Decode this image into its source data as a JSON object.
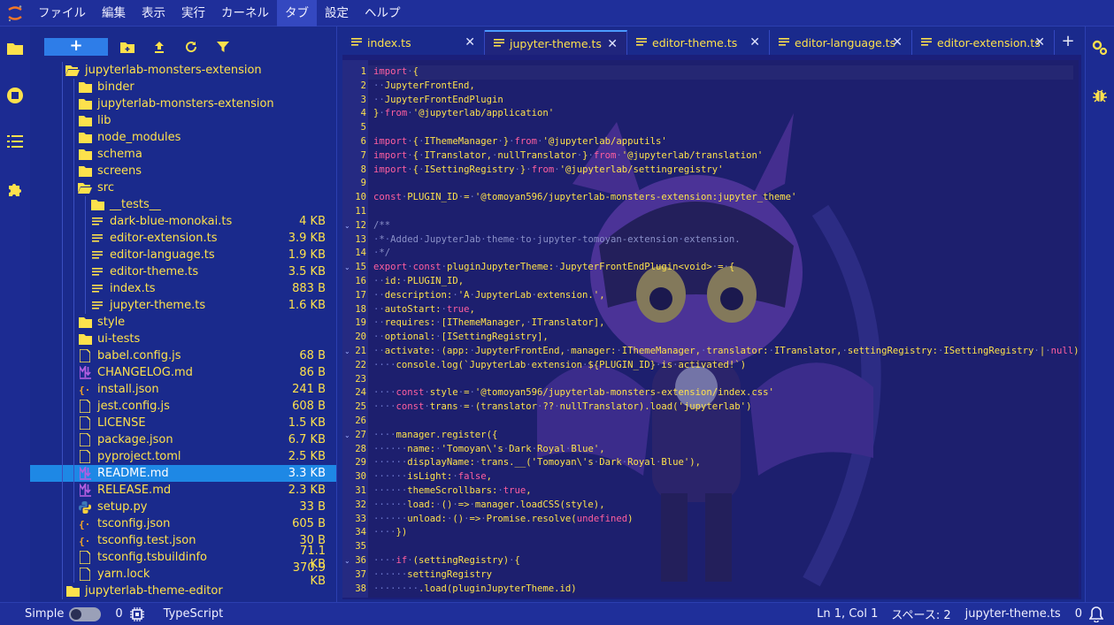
{
  "menu": [
    "ファイル",
    "編集",
    "表示",
    "実行",
    "カーネル",
    "タブ",
    "設定",
    "ヘルプ"
  ],
  "menu_active_index": 5,
  "filebrowser": {
    "new_label": "+",
    "root": "jupyterlab-monsters-extension",
    "items": [
      {
        "name": "jupyterlab-monsters-extension",
        "size": "",
        "type": "folder-open",
        "depth": 0
      },
      {
        "name": "binder",
        "size": "",
        "type": "folder",
        "depth": 1
      },
      {
        "name": "jupyterlab-monsters-extension",
        "size": "",
        "type": "folder",
        "depth": 1
      },
      {
        "name": "lib",
        "size": "",
        "type": "folder",
        "depth": 1
      },
      {
        "name": "node_modules",
        "size": "",
        "type": "folder",
        "depth": 1
      },
      {
        "name": "schema",
        "size": "",
        "type": "folder",
        "depth": 1
      },
      {
        "name": "screens",
        "size": "",
        "type": "folder",
        "depth": 1
      },
      {
        "name": "src",
        "size": "",
        "type": "folder-open",
        "depth": 1
      },
      {
        "name": "__tests__",
        "size": "",
        "type": "folder",
        "depth": 2
      },
      {
        "name": "dark-blue-monokai.ts",
        "size": "4 KB",
        "type": "ts",
        "depth": 2
      },
      {
        "name": "editor-extension.ts",
        "size": "3.9 KB",
        "type": "ts",
        "depth": 2
      },
      {
        "name": "editor-language.ts",
        "size": "1.9 KB",
        "type": "ts",
        "depth": 2
      },
      {
        "name": "editor-theme.ts",
        "size": "3.5 KB",
        "type": "ts",
        "depth": 2
      },
      {
        "name": "index.ts",
        "size": "883 B",
        "type": "ts",
        "depth": 2
      },
      {
        "name": "jupyter-theme.ts",
        "size": "1.6 KB",
        "type": "ts",
        "depth": 2
      },
      {
        "name": "style",
        "size": "",
        "type": "folder",
        "depth": 1
      },
      {
        "name": "ui-tests",
        "size": "",
        "type": "folder",
        "depth": 1
      },
      {
        "name": "babel.config.js",
        "size": "68 B",
        "type": "file",
        "depth": 1
      },
      {
        "name": "CHANGELOG.md",
        "size": "86 B",
        "type": "md",
        "depth": 1
      },
      {
        "name": "install.json",
        "size": "241 B",
        "type": "json",
        "depth": 1
      },
      {
        "name": "jest.config.js",
        "size": "608 B",
        "type": "file",
        "depth": 1
      },
      {
        "name": "LICENSE",
        "size": "1.5 KB",
        "type": "file",
        "depth": 1
      },
      {
        "name": "package.json",
        "size": "6.7 KB",
        "type": "file",
        "depth": 1
      },
      {
        "name": "pyproject.toml",
        "size": "2.5 KB",
        "type": "file",
        "depth": 1
      },
      {
        "name": "README.md",
        "size": "3.3 KB",
        "type": "md",
        "depth": 1,
        "selected": true
      },
      {
        "name": "RELEASE.md",
        "size": "2.3 KB",
        "type": "md",
        "depth": 1
      },
      {
        "name": "setup.py",
        "size": "33 B",
        "type": "py",
        "depth": 1
      },
      {
        "name": "tsconfig.json",
        "size": "605 B",
        "type": "json",
        "depth": 1
      },
      {
        "name": "tsconfig.test.json",
        "size": "30 B",
        "type": "json",
        "depth": 1
      },
      {
        "name": "tsconfig.tsbuildinfo",
        "size": "71.1 KB",
        "type": "file",
        "depth": 1
      },
      {
        "name": "yarn.lock",
        "size": "370.9 KB",
        "type": "file",
        "depth": 1
      },
      {
        "name": "jupyterlab-theme-editor",
        "size": "",
        "type": "folder",
        "depth": 0
      }
    ]
  },
  "tabs": [
    {
      "label": "index.ts",
      "active": false
    },
    {
      "label": "jupyter-theme.ts",
      "active": true
    },
    {
      "label": "editor-theme.ts",
      "active": false
    },
    {
      "label": "editor-language.ts",
      "active": false
    },
    {
      "label": "editor-extension.ts",
      "active": false
    }
  ],
  "code": [
    {
      "n": "1",
      "t": "import·{"
    },
    {
      "n": "2",
      "t": "··JupyterFrontEnd,"
    },
    {
      "n": "3",
      "t": "··JupyterFrontEndPlugin"
    },
    {
      "n": "4",
      "t": "}·from·'@jupyterlab/application'"
    },
    {
      "n": "5",
      "t": ""
    },
    {
      "n": "6",
      "t": "import·{·IThemeManager·}·from·'@jupyterlab/apputils'"
    },
    {
      "n": "7",
      "t": "import·{·ITranslator,·nullTranslator·}·from·'@jupyterlab/translation'"
    },
    {
      "n": "8",
      "t": "import·{·ISettingRegistry·}·from·'@jupyterlab/settingregistry'"
    },
    {
      "n": "9",
      "t": ""
    },
    {
      "n": "10",
      "t": "const·PLUGIN_ID·=·'@tomoyan596/jupyterlab-monsters-extension:jupyter_theme'"
    },
    {
      "n": "11",
      "t": ""
    },
    {
      "n": "12",
      "t": "/**",
      "fold": true
    },
    {
      "n": "13",
      "t": "·*·Added·JupyterJab·theme·to·jupyter-tomoyan-extension·extension."
    },
    {
      "n": "14",
      "t": "·*/"
    },
    {
      "n": "15",
      "t": "export·const·pluginJupyterTheme:·JupyterFrontEndPlugin<void>·=·{",
      "fold": true
    },
    {
      "n": "16",
      "t": "··id:·PLUGIN_ID,"
    },
    {
      "n": "17",
      "t": "··description:·'A·JupyterLab·extension.',"
    },
    {
      "n": "18",
      "t": "··autoStart:·true,"
    },
    {
      "n": "19",
      "t": "··requires:·[IThemeManager,·ITranslator],"
    },
    {
      "n": "20",
      "t": "··optional:·[ISettingRegistry],"
    },
    {
      "n": "21",
      "t": "··activate:·(app:·JupyterFrontEnd,·manager:·IThemeManager,·translator:·ITranslator,·settingRegistry:·ISettingRegistry·|·null)·=>·{",
      "fold": true
    },
    {
      "n": "22",
      "t": "····console.log(`JupyterLab·extension·${PLUGIN_ID}·is·activated!`)"
    },
    {
      "n": "23",
      "t": ""
    },
    {
      "n": "24",
      "t": "····const·style·=·'@tomoyan596/jupyterlab-monsters-extension/index.css'"
    },
    {
      "n": "25",
      "t": "····const·trans·=·(translator·??·nullTranslator).load('jupyterlab')"
    },
    {
      "n": "26",
      "t": ""
    },
    {
      "n": "27",
      "t": "····manager.register({",
      "fold": true
    },
    {
      "n": "28",
      "t": "······name:·'Tomoyan\\'s·Dark·Royal·Blue',"
    },
    {
      "n": "29",
      "t": "······displayName:·trans.__('Tomoyan\\'s·Dark·Royal·Blue'),"
    },
    {
      "n": "30",
      "t": "······isLight:·false,"
    },
    {
      "n": "31",
      "t": "······themeScrollbars:·true,"
    },
    {
      "n": "32",
      "t": "······load:·()·=>·manager.loadCSS(style),"
    },
    {
      "n": "33",
      "t": "······unload:·()·=>·Promise.resolve(undefined)"
    },
    {
      "n": "34",
      "t": "····})"
    },
    {
      "n": "35",
      "t": ""
    },
    {
      "n": "36",
      "t": "····if·(settingRegistry)·{",
      "fold": true
    },
    {
      "n": "37",
      "t": "······settingRegistry"
    },
    {
      "n": "38",
      "t": "········.load(pluginJupyterTheme.id)"
    }
  ],
  "status": {
    "mode": "Simple",
    "kernels": "0",
    "language": "TypeScript",
    "position": "Ln 1, Col 1",
    "spaces": "スペース: 2",
    "filename": "jupyter-theme.ts",
    "notifications": "0"
  },
  "colors": {
    "background": "#1a2a8c",
    "accent": "#2e7de8",
    "selection": "#1e88e5",
    "file_text": "#fde14c",
    "keyword": "#ff5f9f",
    "string": "#fde14c"
  }
}
